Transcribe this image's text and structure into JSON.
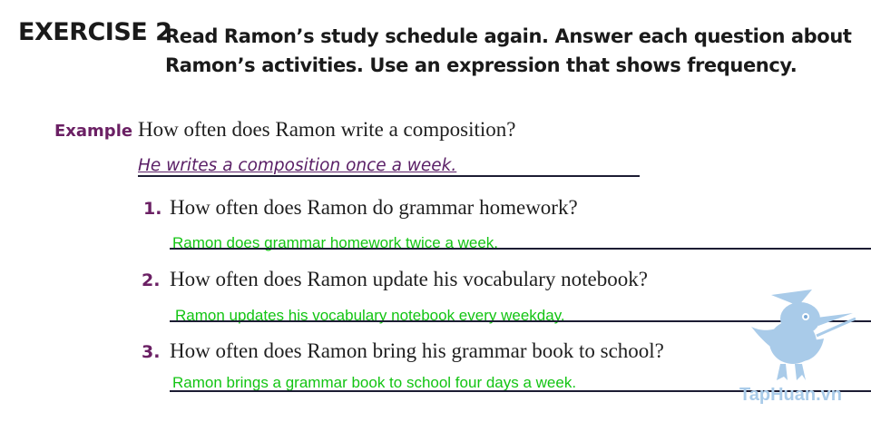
{
  "exercise": {
    "heading": "EXERCISE 2",
    "instruction": "Read Ramon’s study schedule again. Answer each question about Ramon’s activities. Use an expression that shows frequency."
  },
  "example": {
    "label": "Example",
    "question": "How often does Ramon write a composition?",
    "answer": "He writes a composition once a week."
  },
  "questions": [
    {
      "number": "1.",
      "text": "How often does Ramon do grammar homework?",
      "answer": "Ramon does grammar homework twice a week."
    },
    {
      "number": "2.",
      "text": "How often does Ramon update his vocabulary notebook?",
      "answer": "Ramon updates his vocabulary notebook every weekday."
    },
    {
      "number": "3.",
      "text": "How often does Ramon bring his grammar book to school?",
      "answer": "Ramon brings a grammar book to school four days a week."
    }
  ],
  "watermark": "TapHuan.vn",
  "colors": {
    "accent": "#6b2064",
    "answer_green": "#13c413",
    "example_answer": "#5a1f66"
  }
}
